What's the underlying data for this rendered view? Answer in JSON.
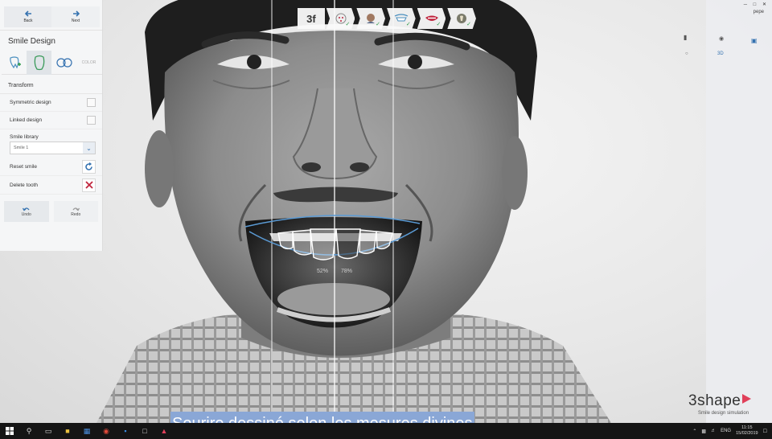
{
  "nav": {
    "back_label": "Back",
    "next_label": "Next"
  },
  "panel": {
    "title": "Smile Design",
    "tools": [
      {
        "icon": "tooth-plus-icon"
      },
      {
        "icon": "tooth-outline-icon"
      },
      {
        "icon": "tooth-pair-icon"
      },
      {
        "label": "COLOR"
      }
    ],
    "transform_label": "Transform",
    "options": [
      {
        "label": "Symmetric design",
        "checked": false
      },
      {
        "label": "Linked design",
        "checked": false
      }
    ],
    "library_label": "Smile library",
    "library_value": "Smile 1",
    "reset_label": "Reset smile",
    "delete_label": "Delete tooth",
    "undo_label": "Undo",
    "redo_label": "Redo"
  },
  "workflow": {
    "steps": [
      {
        "icon": "workflow-logo-icon",
        "label": "3f",
        "done": false
      },
      {
        "icon": "face-points-icon",
        "done": true
      },
      {
        "icon": "face-profile-icon",
        "done": true
      },
      {
        "icon": "teeth-arch-icon",
        "done": true
      },
      {
        "icon": "lips-icon",
        "done": true
      },
      {
        "icon": "tooth-color-icon",
        "done": true
      }
    ]
  },
  "right_panel": {
    "user": "pepe"
  },
  "overlay": {
    "left_ratio": "52%",
    "right_ratio": "78%"
  },
  "brand": {
    "name": "3shape",
    "subtitle": "Smile design simulation"
  },
  "subtitle_caption": "Sourire dessiné selon les mesures divines",
  "taskbar": {
    "lang": "ENG",
    "time": "11:15",
    "date": "15/02/2019"
  },
  "colors": {
    "accent": "#3572b0",
    "delete": "#c0263e",
    "check": "#2e9c4a",
    "brand": "#e0405a",
    "caption_bg": "#8aa7d6"
  }
}
